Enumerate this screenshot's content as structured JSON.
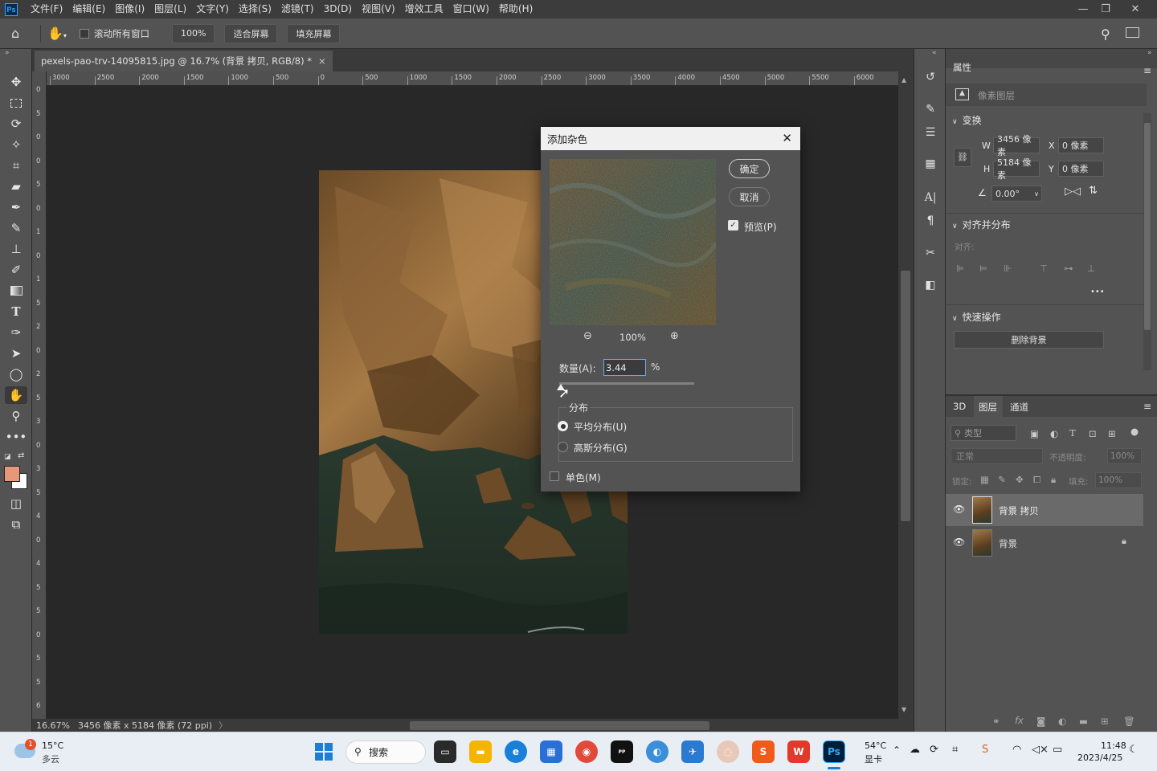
{
  "menubar": {
    "logo": "Ps",
    "items": [
      "文件(F)",
      "编辑(E)",
      "图像(I)",
      "图层(L)",
      "文字(Y)",
      "选择(S)",
      "滤镜(T)",
      "3D(D)",
      "视图(V)",
      "增效工具",
      "窗口(W)",
      "帮助(H)"
    ]
  },
  "options": {
    "scroll_all_windows": "滚动所有窗口",
    "zoom_100": "100%",
    "fit_screen": "适合屏幕",
    "fill_screen": "填充屏幕"
  },
  "document": {
    "tab_title": "pexels-pao-trv-14095815.jpg @ 16.7% (背景 拷贝, RGB/8) *",
    "close": "×"
  },
  "ruler_h": [
    "3000",
    "2500",
    "2000",
    "1500",
    "1000",
    "500",
    "0",
    "500",
    "1000",
    "1500",
    "2000",
    "2500",
    "3000",
    "3500",
    "4000",
    "4500",
    "5000",
    "5500",
    "6000"
  ],
  "ruler_v": [
    "0",
    "5",
    "0",
    "0",
    "5",
    "0",
    "1",
    "0",
    "1",
    "5",
    "2",
    "0",
    "2",
    "5",
    "3",
    "0",
    "3",
    "5",
    "4",
    "0",
    "4",
    "5",
    "5",
    "0",
    "5",
    "5",
    "6"
  ],
  "status": {
    "zoom": "16.67%",
    "info": "3456 像素 x 5184 像素 (72 ppi)",
    "arrow": "〉"
  },
  "dialog": {
    "title": "添加杂色",
    "ok": "确定",
    "cancel": "取消",
    "preview_label": "预览(P)",
    "preview_checked": true,
    "zoom_level": "100%",
    "amount_label": "数量(A):",
    "amount_value": "3.44",
    "amount_unit": "%",
    "amount_slider_fraction": 0.01,
    "distribution_label": "分布",
    "uniform_label": "平均分布(U)",
    "gaussian_label": "高斯分布(G)",
    "selected_distribution": "uniform",
    "monochromatic_label": "单色(M)",
    "monochromatic_checked": false
  },
  "properties": {
    "tab": "属性",
    "layer_type": "像素图层",
    "transform_title": "变换",
    "w_label": "W",
    "w_value": "3456 像素",
    "h_label": "H",
    "h_value": "5184 像素",
    "x_label": "X",
    "x_value": "0 像素",
    "y_label": "Y",
    "y_value": "0 像素",
    "angle_value": "0.00°",
    "align_title": "对齐并分布",
    "align_sub": "对齐:",
    "more": "•••",
    "quick_actions_title": "快速操作",
    "remove_bg": "删除背景"
  },
  "layers_panel": {
    "tabs": [
      "3D",
      "图层",
      "通道"
    ],
    "active_tab": "图层",
    "filter_placeholder": "类型",
    "blend_mode": "正常",
    "opacity_label": "不透明度:",
    "opacity_value": "100%",
    "lock_label": "锁定:",
    "fill_label": "填充:",
    "fill_value": "100%",
    "layers": [
      {
        "name": "背景 拷贝",
        "selected": true,
        "locked": false
      },
      {
        "name": "背景",
        "selected": false,
        "locked": true
      }
    ]
  },
  "taskbar": {
    "weather_temp": "15°C",
    "weather_desc": "多云",
    "weather_badge": "1",
    "search_label": "搜索",
    "gpu_temp": "54°C",
    "gpu_label": "显卡",
    "time": "11:48",
    "date": "2023/4/25"
  },
  "colors": {
    "accent": "#31a8ff",
    "foreground": "#e8987a",
    "background": "#ffffff"
  }
}
